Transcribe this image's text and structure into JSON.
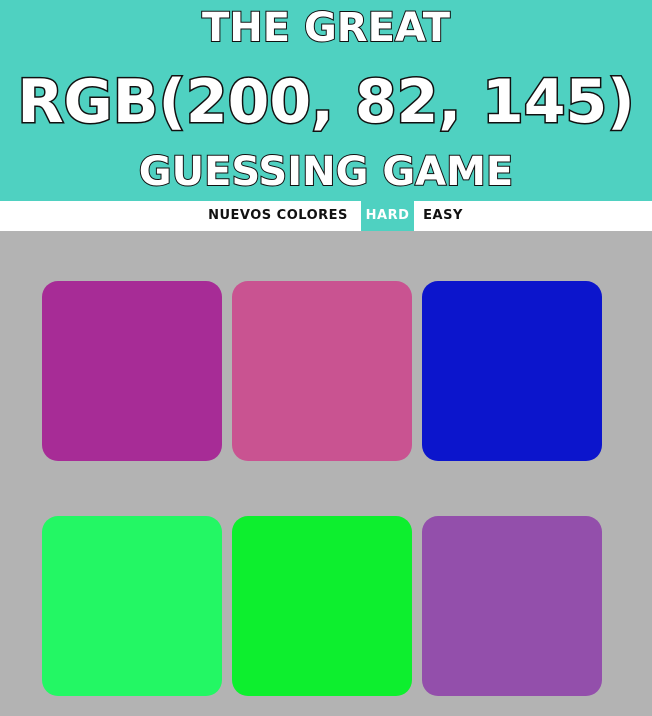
{
  "header": {
    "title_top": "THE GREAT",
    "rgb_display": "RGB(200, 82, 145)",
    "title_bottom": "GUESSING GAME",
    "background_color": "#4fd1c1"
  },
  "stripe": {
    "new_colors_label": "NUEVOS COLORES",
    "hard_label": "HARD",
    "easy_label": "EASY",
    "selected_mode": "HARD",
    "accent_color": "#4fd1c1"
  },
  "board": {
    "background_color": "#b3b3b3",
    "squares": [
      {
        "color": "#a72c96"
      },
      {
        "color": "#c95391"
      },
      {
        "color": "#0c15cc"
      },
      {
        "color": "#23f764"
      },
      {
        "color": "#0def2e"
      },
      {
        "color": "#934fab"
      }
    ]
  }
}
